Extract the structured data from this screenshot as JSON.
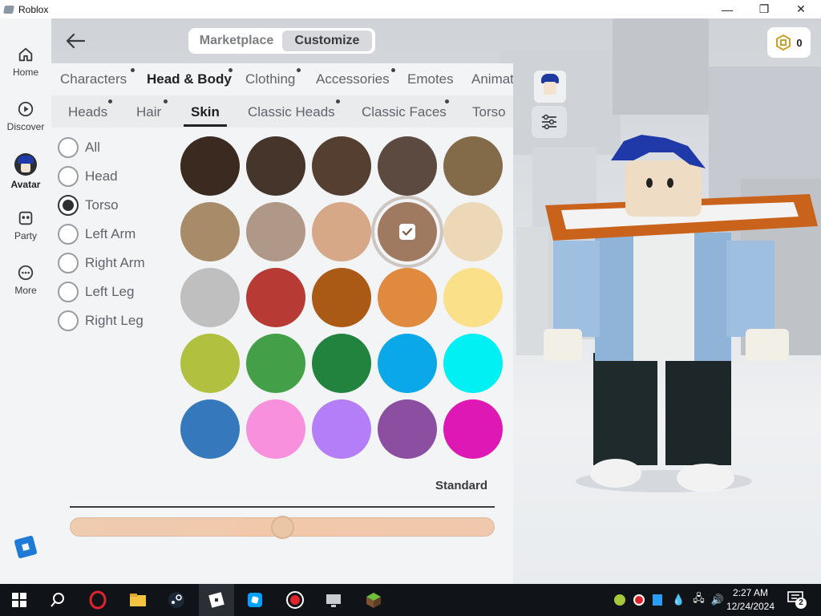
{
  "window": {
    "title": "Roblox",
    "minimize": "—",
    "restore": "❐",
    "close": "✕"
  },
  "rail": {
    "items": [
      {
        "label": "Home",
        "icon": "home-icon"
      },
      {
        "label": "Discover",
        "icon": "play-icon"
      },
      {
        "label": "Avatar",
        "icon": "avatar-icon"
      },
      {
        "label": "Party",
        "icon": "party-icon"
      },
      {
        "label": "More",
        "icon": "more-icon"
      }
    ]
  },
  "header": {
    "back_icon": "arrow-left-icon",
    "segments": [
      {
        "label": "Marketplace",
        "active": false
      },
      {
        "label": "Customize",
        "active": true
      }
    ],
    "robux": {
      "icon": "robux-icon",
      "value": "0"
    }
  },
  "tabs_primary": [
    {
      "label": "Characters",
      "dot": true
    },
    {
      "label": "Head & Body",
      "dot": true,
      "active": true
    },
    {
      "label": "Clothing",
      "dot": true
    },
    {
      "label": "Accessories",
      "dot": true
    },
    {
      "label": "Emotes",
      "dot": false
    },
    {
      "label": "Animations",
      "dot": false
    }
  ],
  "tabs_secondary": [
    {
      "label": "Heads",
      "dot": true
    },
    {
      "label": "Hair",
      "dot": true
    },
    {
      "label": "Skin",
      "dot": false,
      "active": true
    },
    {
      "label": "Classic Heads",
      "dot": true
    },
    {
      "label": "Classic Faces",
      "dot": true
    },
    {
      "label": "Torso",
      "dot": false
    }
  ],
  "body_parts": [
    {
      "label": "All",
      "selected": false
    },
    {
      "label": "Head",
      "selected": false
    },
    {
      "label": "Torso",
      "selected": true
    },
    {
      "label": "Left Arm",
      "selected": false
    },
    {
      "label": "Right Arm",
      "selected": false
    },
    {
      "label": "Left Leg",
      "selected": false
    },
    {
      "label": "Right Leg",
      "selected": false
    }
  ],
  "swatches": [
    "#3a2a20",
    "#46352b",
    "#553f30",
    "#5c4a40",
    "#836a48",
    "#a88c6a",
    "#b09888",
    "#d6a888",
    "#9f7a60",
    "#ecd8b6",
    "#bfbfbf",
    "#b83a35",
    "#aa5a14",
    "#e08a40",
    "#fbe08a",
    "#b2c040",
    "#43a048",
    "#21833e",
    "#0aa8e8",
    "#00f0f4",
    "#3678bc",
    "#f890de",
    "#b47ef8",
    "#8c4ea0",
    "#de18b4"
  ],
  "selected_swatch_index": 8,
  "tone": {
    "label": "Standard",
    "value_fraction": 0.5
  },
  "taskbar": {
    "apps": [
      "windows-start-icon",
      "search-icon",
      "opera-icon",
      "file-explorer-icon",
      "steam-icon",
      "roblox-icon",
      "roblox-studio-icon",
      "record-icon",
      "display-icon",
      "minecraft-icon"
    ],
    "time": "2:27 AM",
    "date": "12/24/2024",
    "notifications": "2"
  }
}
